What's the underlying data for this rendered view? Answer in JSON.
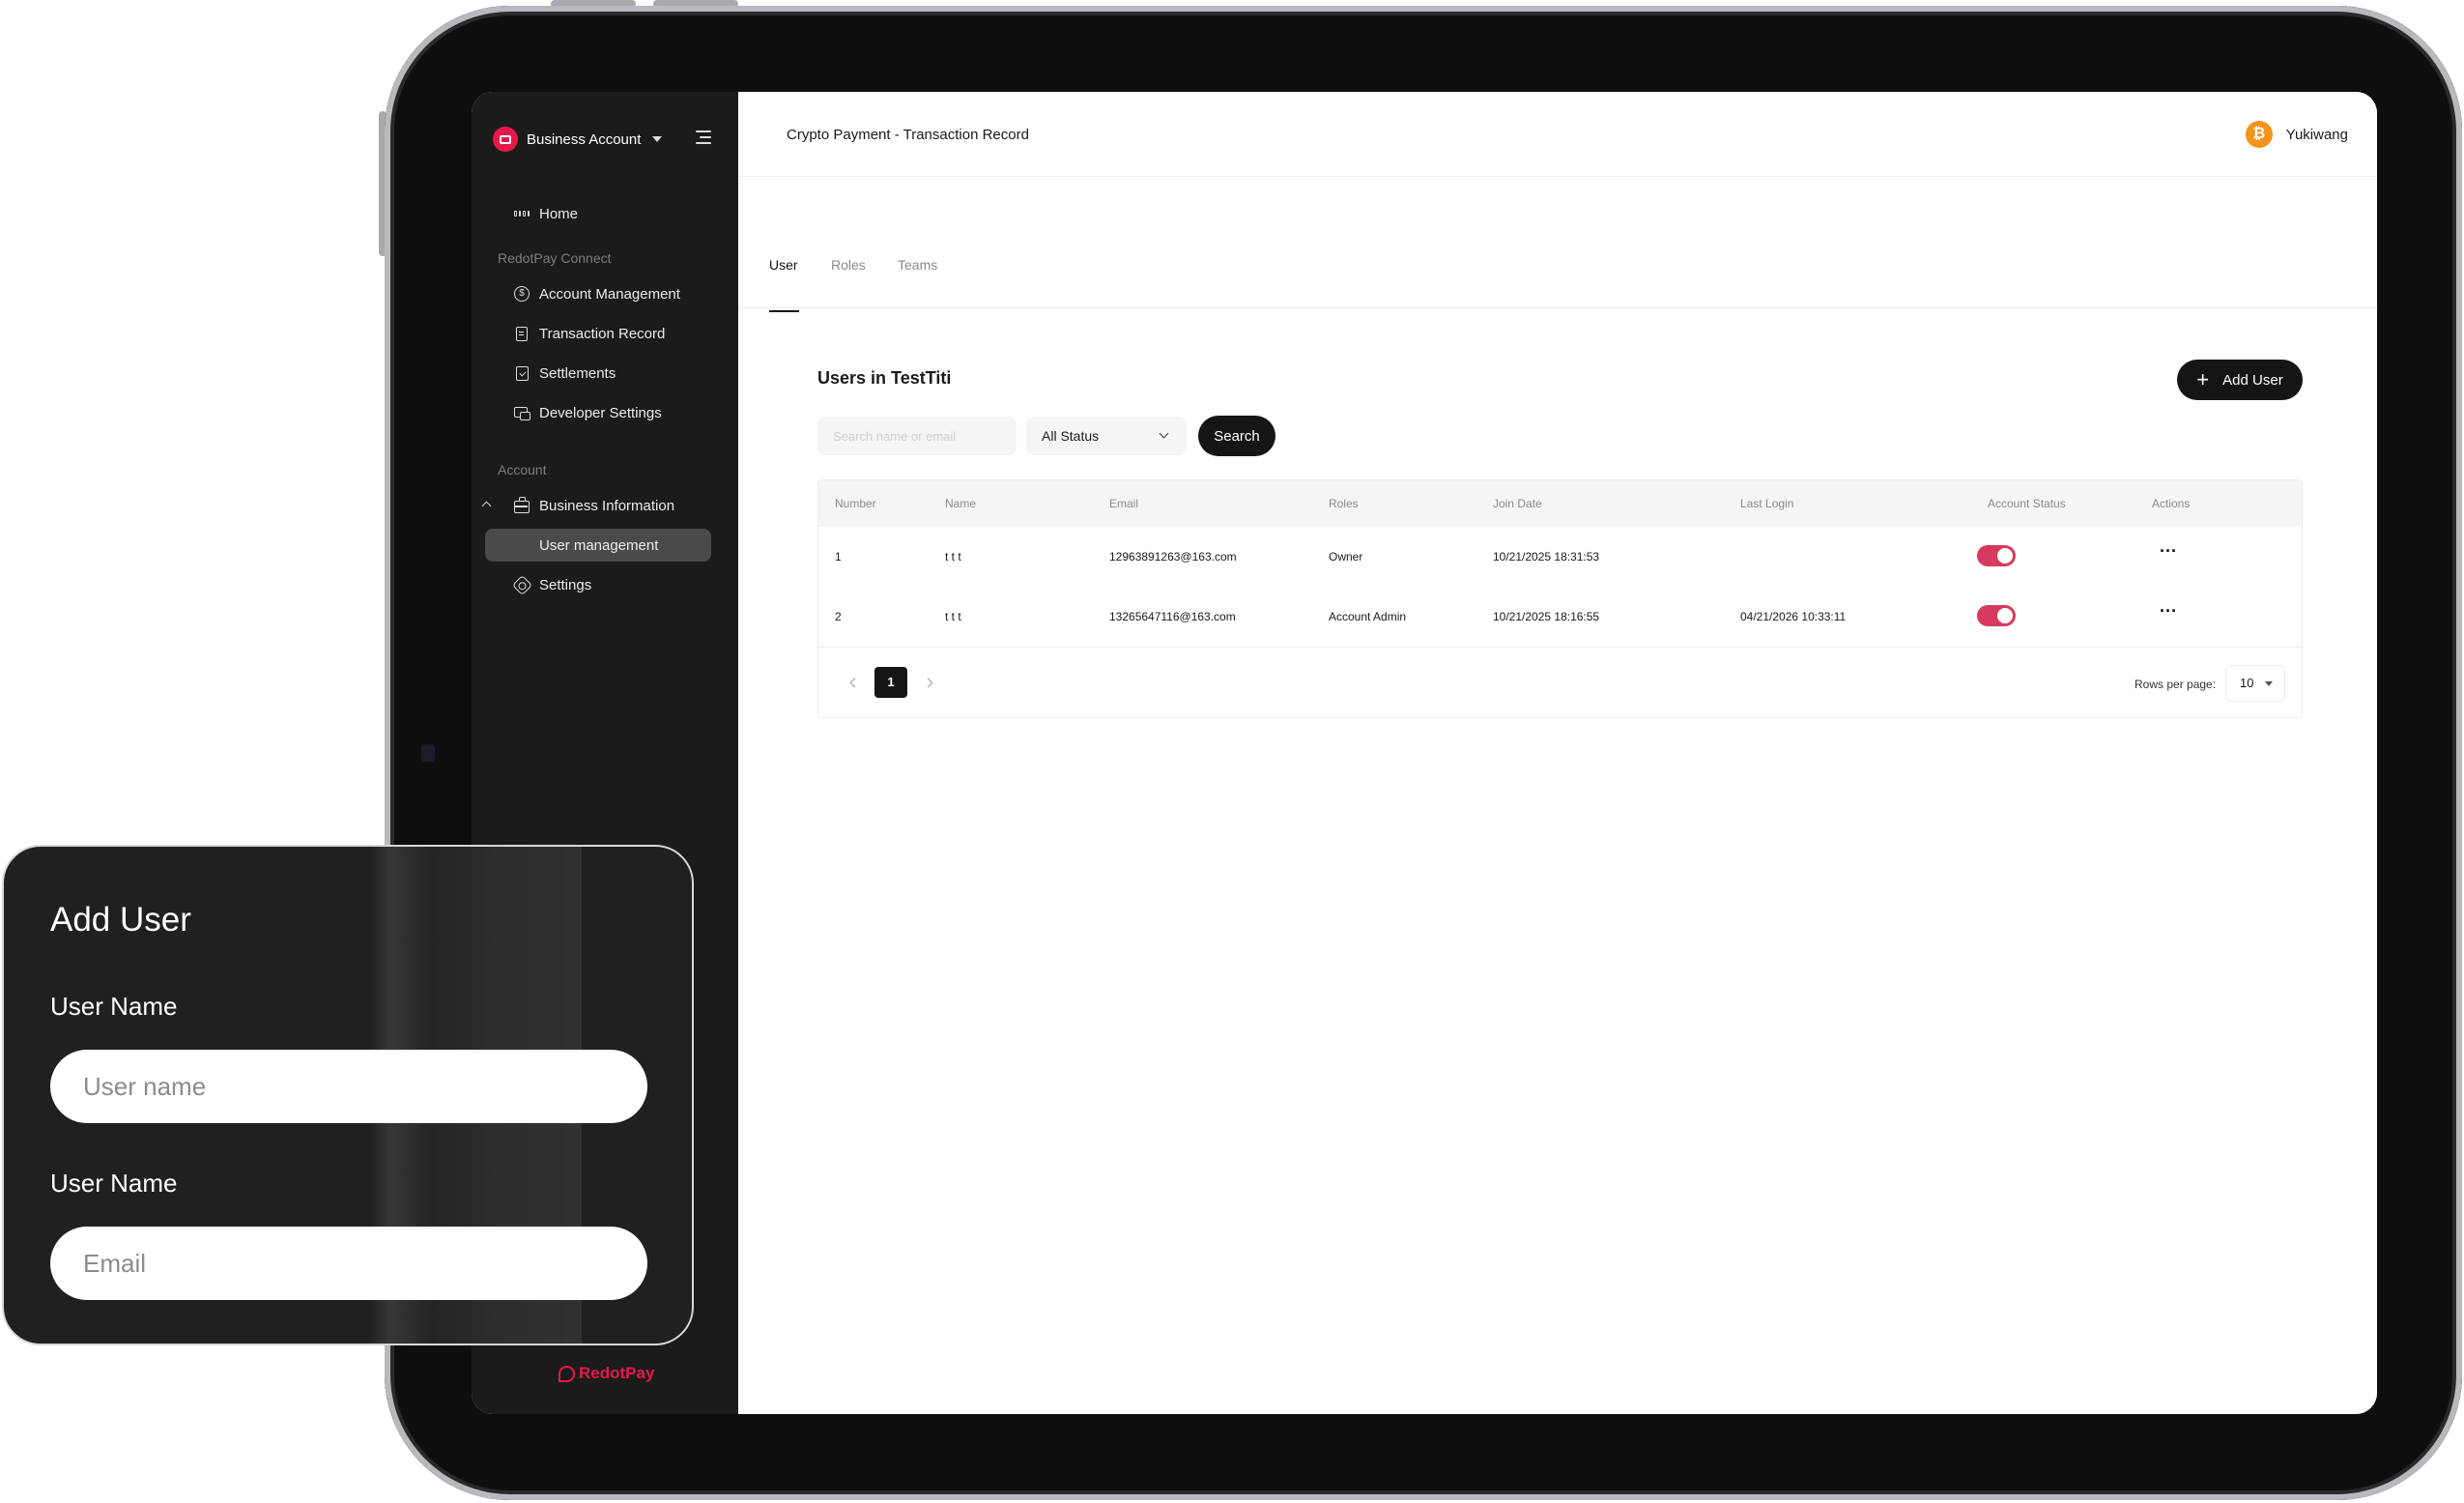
{
  "sidebar": {
    "account_switcher": "Business Account",
    "items": [
      {
        "label": "Home"
      },
      {
        "label": "Account Management"
      },
      {
        "label": "Transaction Record"
      },
      {
        "label": "Settlements"
      },
      {
        "label": "Developer Settings"
      },
      {
        "label": "Business Information"
      },
      {
        "label": "User management"
      },
      {
        "label": "Settings"
      }
    ],
    "sections": {
      "connect": "RedotPay Connect",
      "account": "Account"
    },
    "brand_footer": "RedotPay"
  },
  "header": {
    "title": "Crypto Payment - Transaction Record",
    "user_name": "Yukiwang",
    "avatar_glyph": "₿"
  },
  "tabs": [
    {
      "label": "User",
      "active": true
    },
    {
      "label": "Roles",
      "active": false
    },
    {
      "label": "Teams",
      "active": false
    }
  ],
  "main": {
    "section_title": "Users in TestTiti",
    "add_user_label": "Add User",
    "search_placeholder": "Search name or email",
    "status_filter": "All Status",
    "search_label": "Search"
  },
  "table": {
    "headers": [
      "Number",
      "Name",
      "Email",
      "Roles",
      "Join Date",
      "Last Login",
      "Account Status",
      "Actions"
    ],
    "rows": [
      {
        "number": "1",
        "name": "t t t",
        "email": "12963891263@163.com",
        "role": "Owner",
        "join_date": "10/21/2025 18:31:53",
        "last_login": "",
        "status_on": true
      },
      {
        "number": "2",
        "name": "t t t",
        "email": "13265647116@163.com",
        "role": "Account Admin",
        "join_date": "10/21/2025 18:16:55",
        "last_login": "04/21/2026 10:33:11",
        "status_on": true
      }
    ],
    "pagination": {
      "current_page": "1",
      "rows_per_page_label": "Rows per page:",
      "rows_per_page": "10"
    }
  },
  "overlay": {
    "title": "Add User",
    "field1_label": "User Name",
    "field1_placeholder": "User name",
    "field2_label": "User Name",
    "field2_placeholder": "Email"
  },
  "colors": {
    "accent": "#e5184b",
    "toggle_on": "#d63a5e",
    "dark": "#151515",
    "sidebar_bg": "#1b1b1b"
  }
}
